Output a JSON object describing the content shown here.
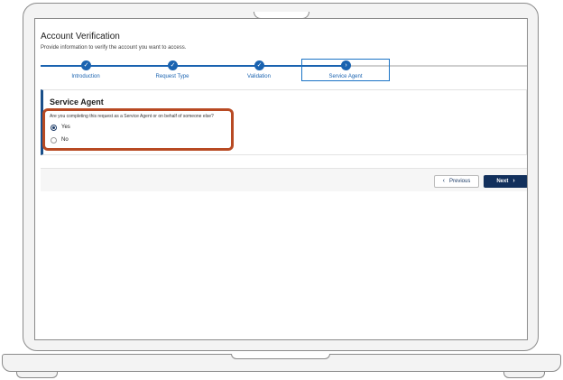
{
  "page": {
    "title": "Account Verification",
    "subtitle": "Provide information to verify the account you want to access."
  },
  "stepper": {
    "steps": [
      {
        "label": "Introduction",
        "status": "complete",
        "icon": "check-icon"
      },
      {
        "label": "Request Type",
        "status": "complete",
        "icon": "check-icon"
      },
      {
        "label": "Validation",
        "status": "complete",
        "icon": "check-icon"
      },
      {
        "label": "Service Agent",
        "status": "current",
        "icon": "chevron-right-icon"
      }
    ]
  },
  "section": {
    "title": "Service Agent",
    "question": "Are you completing this request as a Service Agent or on behalf of someone else?",
    "options": [
      {
        "label": "Yes",
        "selected": true
      },
      {
        "label": "No",
        "selected": false
      }
    ]
  },
  "footer": {
    "previous_label": "Previous",
    "next_label": "Next"
  },
  "colors": {
    "accent": "#1a63b0",
    "primary_button": "#12305c",
    "highlight": "#b84a23"
  }
}
